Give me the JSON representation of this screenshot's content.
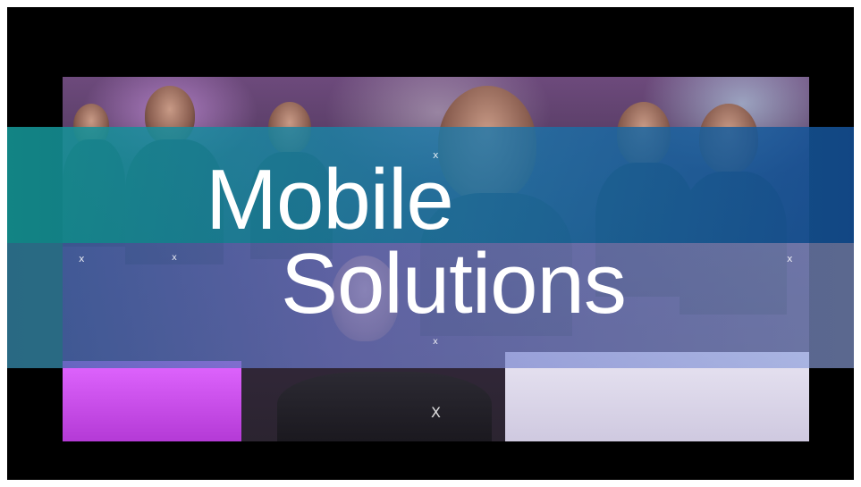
{
  "slide": {
    "title_line1": "Mobile",
    "title_line2": "Solutions",
    "marks": [
      "x",
      "x",
      "x",
      "x",
      "x",
      "X"
    ]
  },
  "colors": {
    "background": "#000000",
    "band_teal": "#1e96a0",
    "band_blue": "#6e78c8",
    "text": "#ffffff"
  }
}
